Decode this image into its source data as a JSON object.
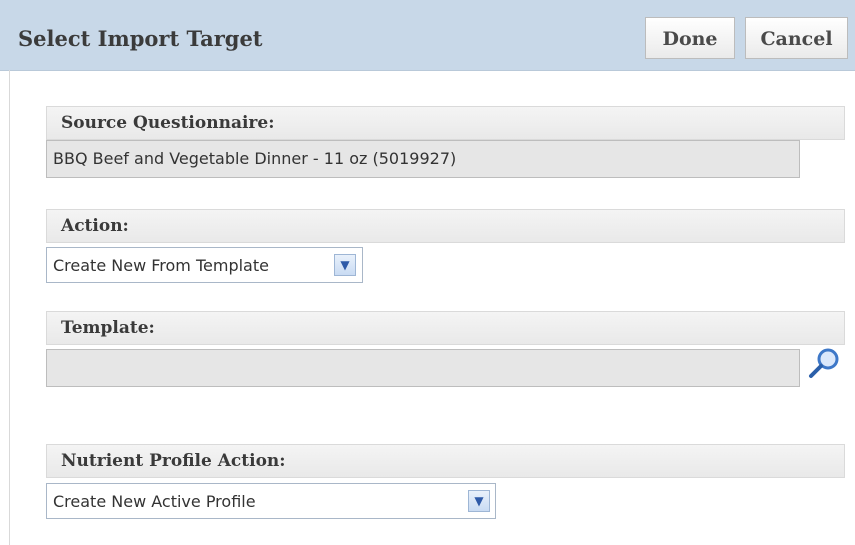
{
  "dialog": {
    "title": "Select Import Target",
    "buttons": {
      "done": "Done",
      "cancel": "Cancel"
    }
  },
  "source_questionnaire": {
    "label": "Source Questionnaire:",
    "value": "BBQ Beef and Vegetable Dinner - 11 oz (5019927)"
  },
  "action": {
    "label": "Action:",
    "selected": "Create New From Template"
  },
  "template": {
    "label": "Template:",
    "value": "",
    "icon": "magnifier-search-icon"
  },
  "nutrient_profile_action": {
    "label": "Nutrient Profile Action:",
    "selected": "Create New Active Profile"
  }
}
